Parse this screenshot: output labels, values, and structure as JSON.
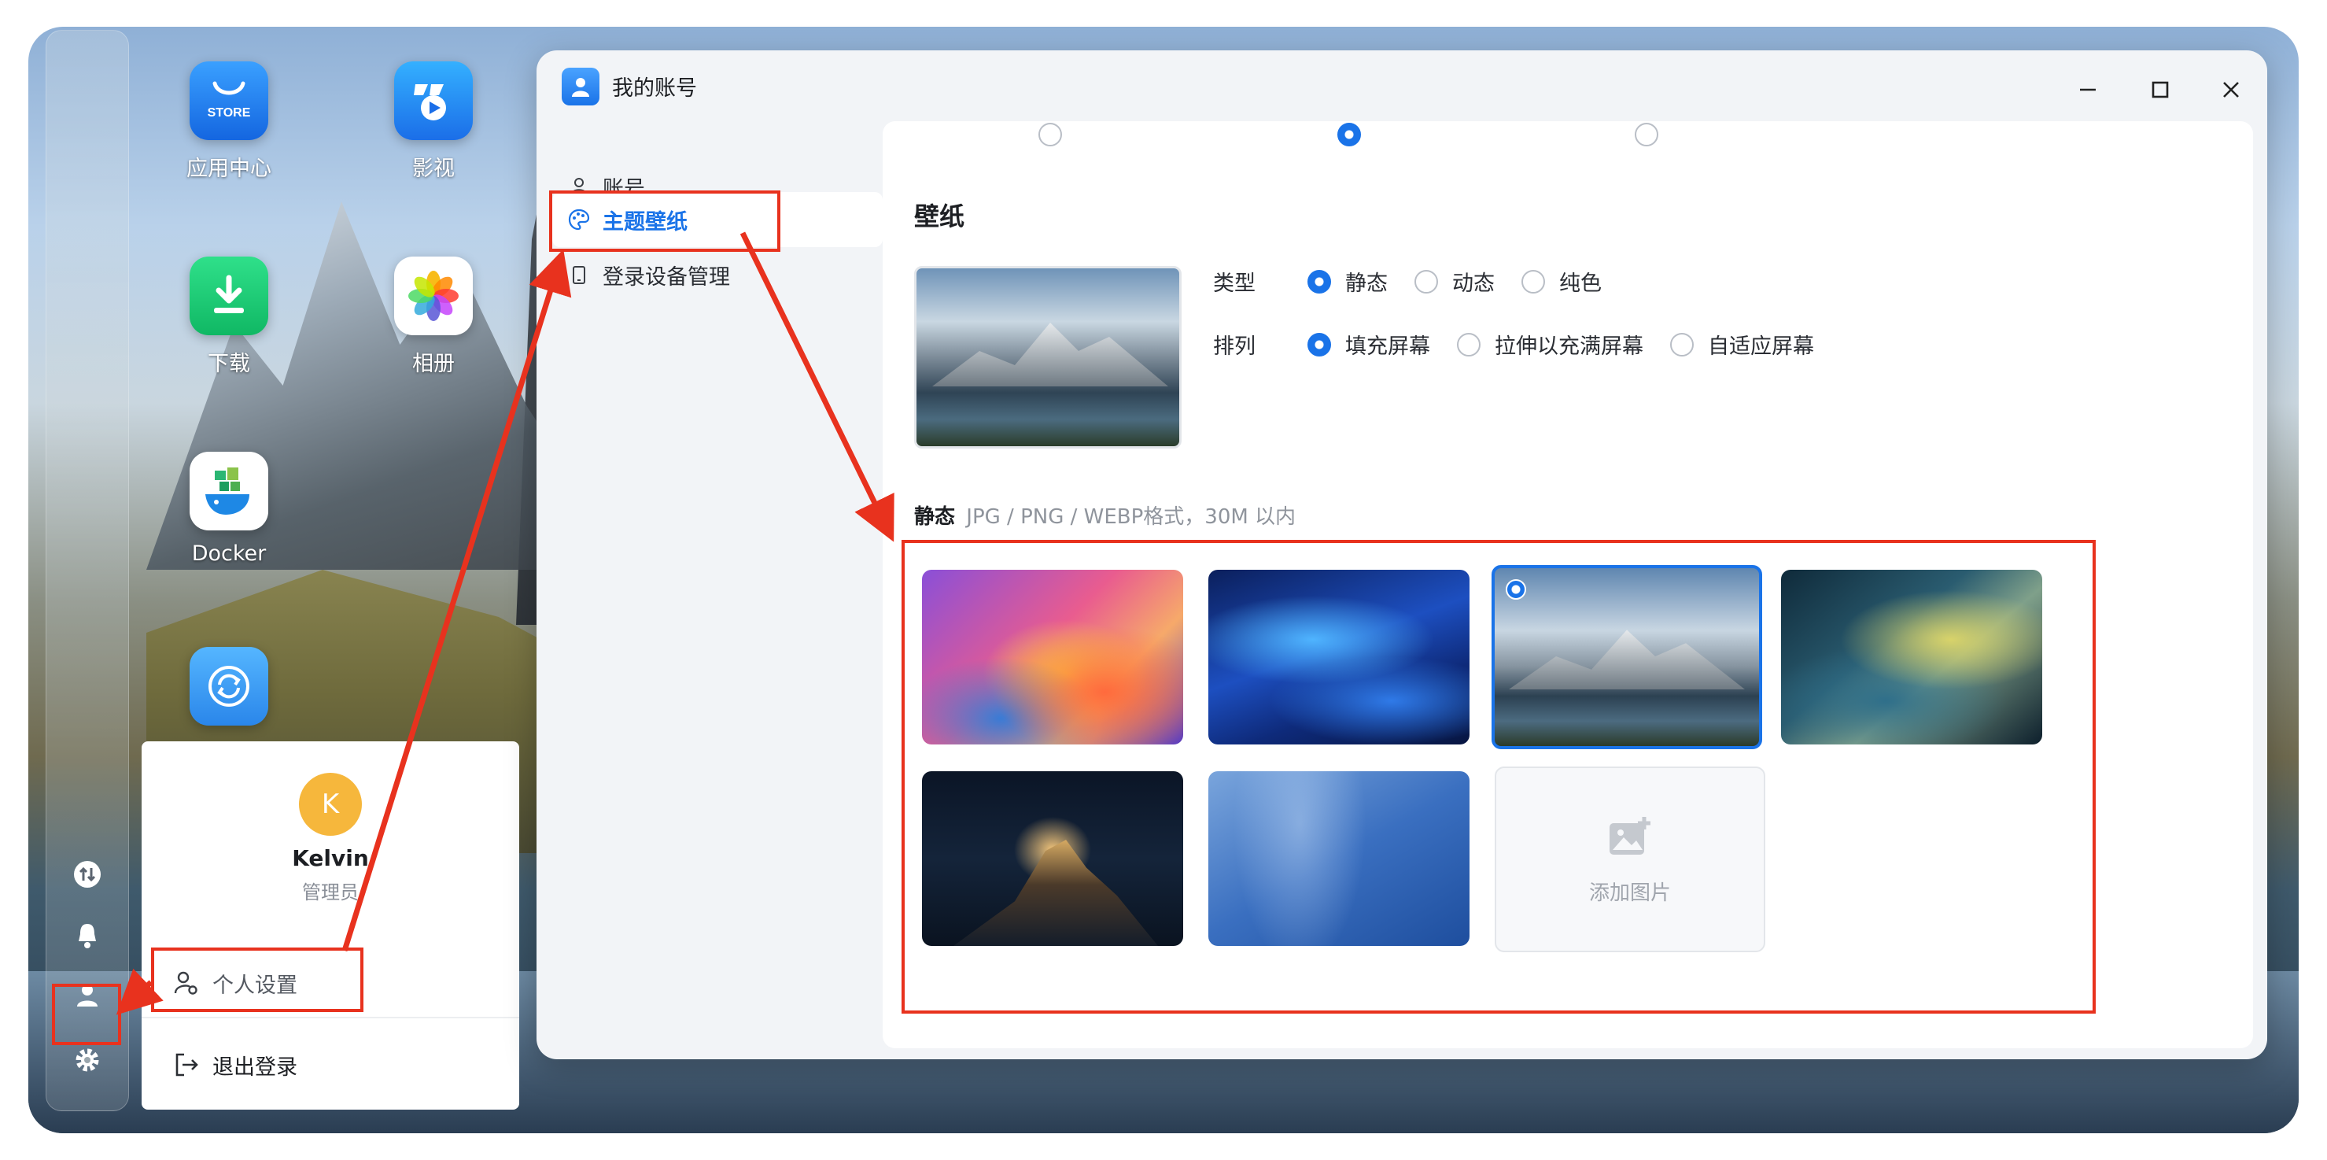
{
  "desktop": {
    "apps": [
      {
        "label": "应用中心",
        "badge": "STORE",
        "icon": "store-icon"
      },
      {
        "label": "影视",
        "icon": "video-icon"
      },
      {
        "label": "下载",
        "icon": "download-icon"
      },
      {
        "label": "相册",
        "icon": "photos-icon"
      },
      {
        "label": "Docker",
        "icon": "docker-icon"
      },
      {
        "label": "",
        "icon": "sync-icon"
      }
    ]
  },
  "dock": {
    "icons": [
      "upload-download-icon",
      "bell-icon",
      "user-icon",
      "gear-icon"
    ]
  },
  "user_menu": {
    "avatar_letter": "K",
    "name": "Kelvin",
    "role": "管理员",
    "settings_label": "个人设置",
    "logout_label": "退出登录"
  },
  "window": {
    "title": "我的账号",
    "sidebar": [
      {
        "label": "账号",
        "icon": "user-outline-icon",
        "active": false
      },
      {
        "label": "主题壁纸",
        "icon": "palette-icon",
        "active": true
      },
      {
        "label": "登录设备管理",
        "icon": "device-icon",
        "active": false
      }
    ]
  },
  "wallpaper": {
    "section_title": "壁纸",
    "type_label": "类型",
    "type_options": [
      "静态",
      "动态",
      "纯色"
    ],
    "type_selected": "静态",
    "arrange_label": "排列",
    "arrange_options": [
      "填充屏幕",
      "拉伸以充满屏幕",
      "自适应屏幕"
    ],
    "arrange_selected": "填充屏幕",
    "static_label": "静态",
    "static_hint": "JPG / PNG / WEBP格式，30M 以内",
    "add_image_label": "添加图片",
    "selected_index": 2
  },
  "colors": {
    "accent": "#1a73e8",
    "annotation_red": "#e8321e"
  }
}
